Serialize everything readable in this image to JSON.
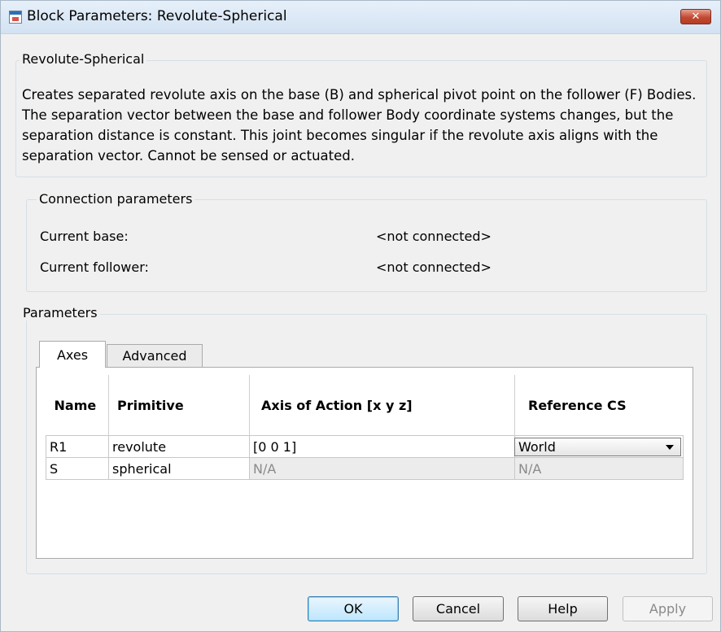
{
  "window": {
    "title": "Block Parameters: Revolute-Spherical",
    "close_glyph": "✕"
  },
  "description_group": {
    "title": "Revolute-Spherical",
    "text": "Creates separated revolute axis on the base (B) and spherical pivot point on the follower (F) Bodies. The separation vector between the base and follower Body coordinate systems changes, but the separation distance is constant. This joint becomes singular if the revolute axis aligns with the separation vector. Cannot be sensed or actuated."
  },
  "connection": {
    "title": "Connection parameters",
    "rows": [
      {
        "label": "Current base:",
        "value": "<not connected>"
      },
      {
        "label": "Current follower:",
        "value": "<not connected>"
      }
    ]
  },
  "parameters": {
    "title": "Parameters",
    "tabs": [
      {
        "label": "Axes",
        "active": true
      },
      {
        "label": "Advanced",
        "active": false
      }
    ],
    "table": {
      "headers": [
        "Name",
        "Primitive",
        "Axis of Action [x y z]",
        "Reference CS"
      ],
      "rows": [
        {
          "name": "R1",
          "primitive": "revolute",
          "axis": "[0 0 1]",
          "reference": "World"
        },
        {
          "name": "S",
          "primitive": "spherical",
          "axis": "N/A",
          "reference": "N/A"
        }
      ]
    }
  },
  "buttons": {
    "ok": "OK",
    "cancel": "Cancel",
    "help": "Help",
    "apply": "Apply"
  },
  "icons": {
    "app": "simulink-block-icon",
    "close": "close-icon",
    "dropdown": "chevron-down-icon"
  },
  "colors": {
    "dialog_background": "#f0f0f0",
    "titlebar": "#dae6f3",
    "close_button": "#c24a31",
    "default_button_border": "#3c7fb1",
    "disabled_text": "#8a8a8a"
  }
}
